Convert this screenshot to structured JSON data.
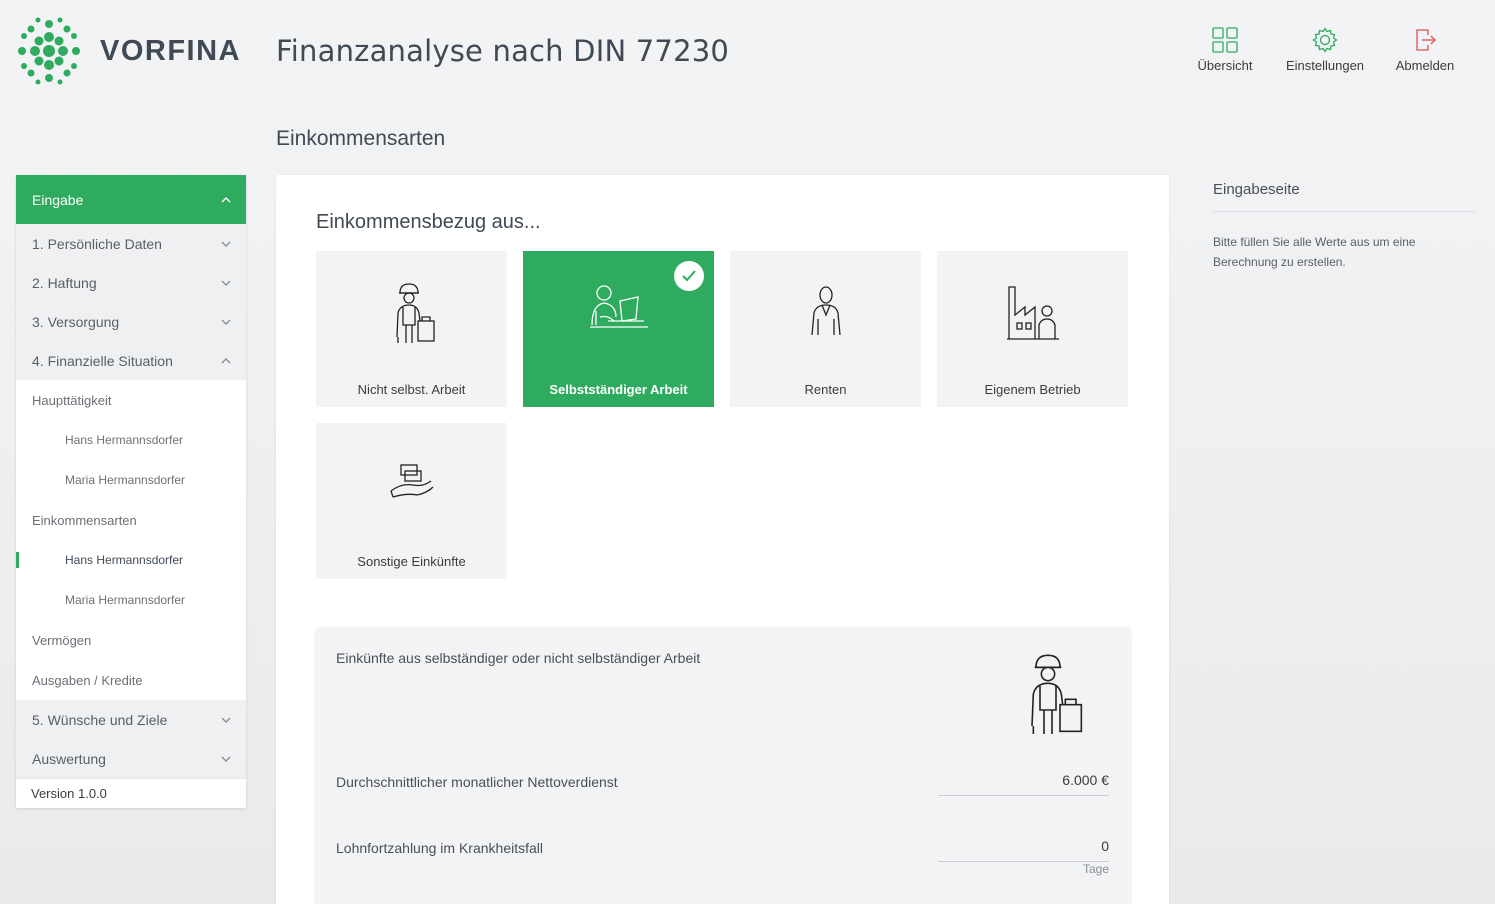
{
  "brand": {
    "name": "VORFINA",
    "color": "#2eab5f"
  },
  "app_title": "Finanzanalyse nach DIN 77230",
  "top_nav": [
    {
      "label": "Übersicht",
      "icon": "grid-icon"
    },
    {
      "label": "Einstellungen",
      "icon": "gear-icon"
    },
    {
      "label": "Abmelden",
      "icon": "logout-icon"
    }
  ],
  "page_heading": "Einkommensarten",
  "sidebar": {
    "header": "Eingabe",
    "sections": [
      {
        "label": "1. Persönliche Daten"
      },
      {
        "label": "2. Haftung"
      },
      {
        "label": "3. Versorgung"
      },
      {
        "label": "4. Finanzielle Situation"
      }
    ],
    "sub": {
      "haupt": "Haupttätigkeit",
      "haupt_leaf1": "Hans Hermannsdorfer",
      "haupt_leaf2": "Maria Hermannsdorfer",
      "einkommen": "Einkommensarten",
      "ein_leaf1": "Hans Hermannsdorfer",
      "ein_leaf2": "Maria Hermannsdorfer",
      "vermoegen": "Vermögen",
      "ausgaben": "Ausgaben / Kredite"
    },
    "sections_after": [
      {
        "label": "5. Wünsche und Ziele"
      },
      {
        "label": "Auswertung"
      }
    ],
    "version": "Version 1.0.0"
  },
  "main": {
    "question": "Einkommensbezug aus...",
    "tiles": [
      {
        "label": "Nicht selbst. Arbeit",
        "selected": false
      },
      {
        "label": "Selbstständiger Arbeit",
        "selected": true
      },
      {
        "label": "Renten",
        "selected": false
      },
      {
        "label": "Eigenem Betrieb",
        "selected": false
      },
      {
        "label": "Sonstige Einkünfte",
        "selected": false
      }
    ],
    "detail": {
      "title": "Einkünfte aus selbständiger oder nicht selbständiger Arbeit",
      "row1_label": "Durchschnittlicher monatlicher Nettoverdienst",
      "row1_value": "6.000  €",
      "row2_label": "Lohnfortzahlung im Krankheitsfall",
      "row2_value": "0",
      "row2_unit": "Tage"
    }
  },
  "info": {
    "title": "Eingabeseite",
    "text": "Bitte füllen Sie alle Werte aus um eine Berechnung zu erstellen."
  }
}
